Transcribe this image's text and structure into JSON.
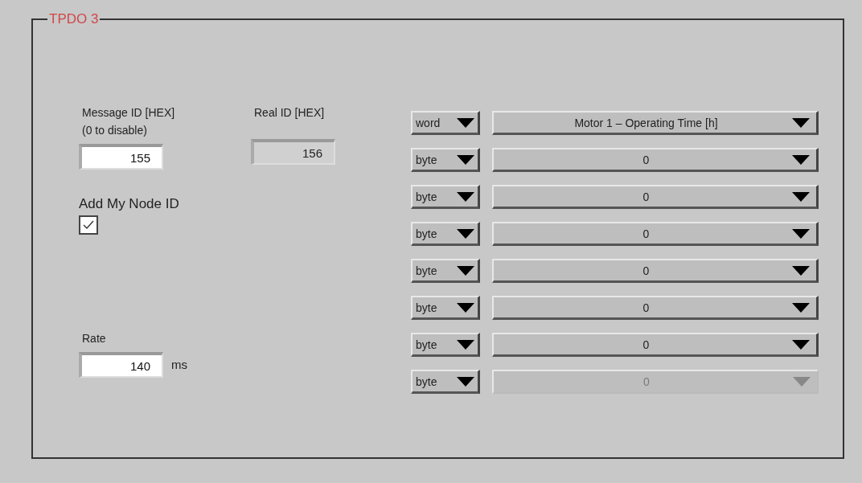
{
  "group": {
    "title": "TPDO 3"
  },
  "message_id": {
    "label": "Message ID [HEX]",
    "note": "(0 to disable)",
    "value": "155"
  },
  "real_id": {
    "label": "Real ID [HEX]",
    "value": "156",
    "disabled": true
  },
  "add_node_id": {
    "label": "Add My Node ID",
    "checked": true
  },
  "rate": {
    "label": "Rate",
    "value": "140",
    "unit": "ms"
  },
  "mappings": [
    {
      "type": "word",
      "value": "Motor 1 – Operating Time [h]",
      "disabled": false
    },
    {
      "type": "byte",
      "value": "0",
      "disabled": false
    },
    {
      "type": "byte",
      "value": "0",
      "disabled": false
    },
    {
      "type": "byte",
      "value": "0",
      "disabled": false
    },
    {
      "type": "byte",
      "value": "0",
      "disabled": false
    },
    {
      "type": "byte",
      "value": "0",
      "disabled": false
    },
    {
      "type": "byte",
      "value": "0",
      "disabled": false
    },
    {
      "type": "byte",
      "value": "0",
      "disabled": true
    }
  ]
}
